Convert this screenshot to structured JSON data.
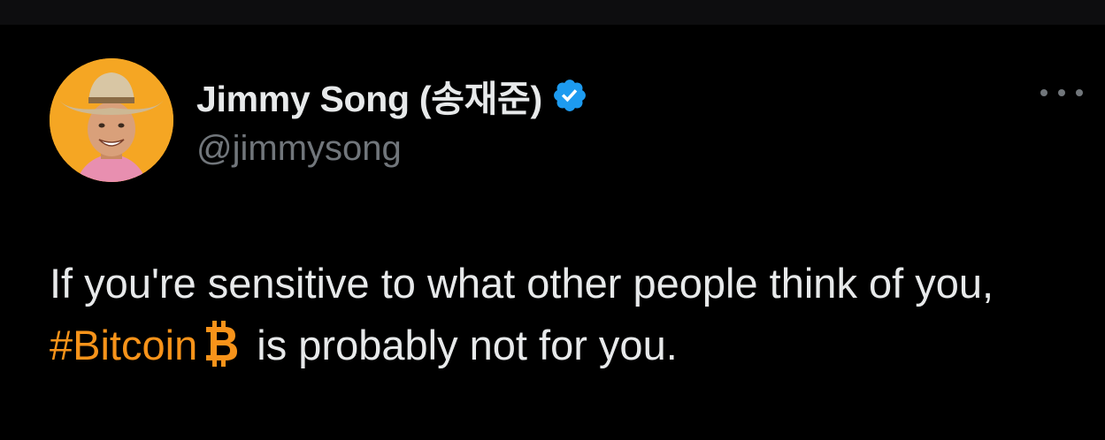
{
  "tweet": {
    "author": {
      "display_name": "Jimmy Song (송재준)",
      "handle": "@jimmysong",
      "verified": true,
      "avatar_icon": "avatar-cowboy-hat"
    },
    "more_icon": "more-horizontal-icon",
    "text": {
      "before": "If you're sensitive to what other people think of you, ",
      "hashtag": "#Bitcoin",
      "emoji": "bitcoin-icon",
      "after": " is probably not for you."
    }
  },
  "colors": {
    "background": "#000000",
    "text": "#e7e9ea",
    "secondary": "#71767b",
    "hashtag": "#f7931a",
    "verified_badge": "#1d9bf0",
    "avatar_bg": "#f5a623"
  }
}
